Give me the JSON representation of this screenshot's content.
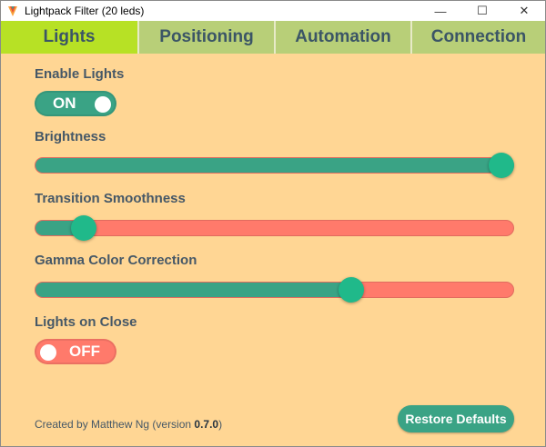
{
  "window": {
    "title": "Lightpack Filter (20 leds)",
    "minimize": "—",
    "maximize": "☐",
    "close": "✕"
  },
  "tabs": [
    {
      "label": "Lights",
      "active": true
    },
    {
      "label": "Positioning",
      "active": false
    },
    {
      "label": "Automation",
      "active": false
    },
    {
      "label": "Connection",
      "active": false
    }
  ],
  "settings": {
    "enable_lights": {
      "label": "Enable Lights",
      "state": "ON"
    },
    "brightness": {
      "label": "Brightness",
      "value": 1.0
    },
    "transition_smoothness": {
      "label": "Transition Smoothness",
      "value": 0.08
    },
    "gamma_color_correction": {
      "label": "Gamma Color Correction",
      "value": 0.67
    },
    "lights_on_close": {
      "label": "Lights on Close",
      "state": "OFF"
    }
  },
  "footer": {
    "prefix": "Created by Matthew Ng (version ",
    "version": "0.7.0",
    "suffix": ")"
  },
  "restore_defaults": {
    "label": "Restore Defaults"
  },
  "colors": {
    "green": "#3aa385",
    "red": "#ff7a6b",
    "background": "#ffd694",
    "active_tab": "#b7e125",
    "tab": "#b8cf78"
  }
}
